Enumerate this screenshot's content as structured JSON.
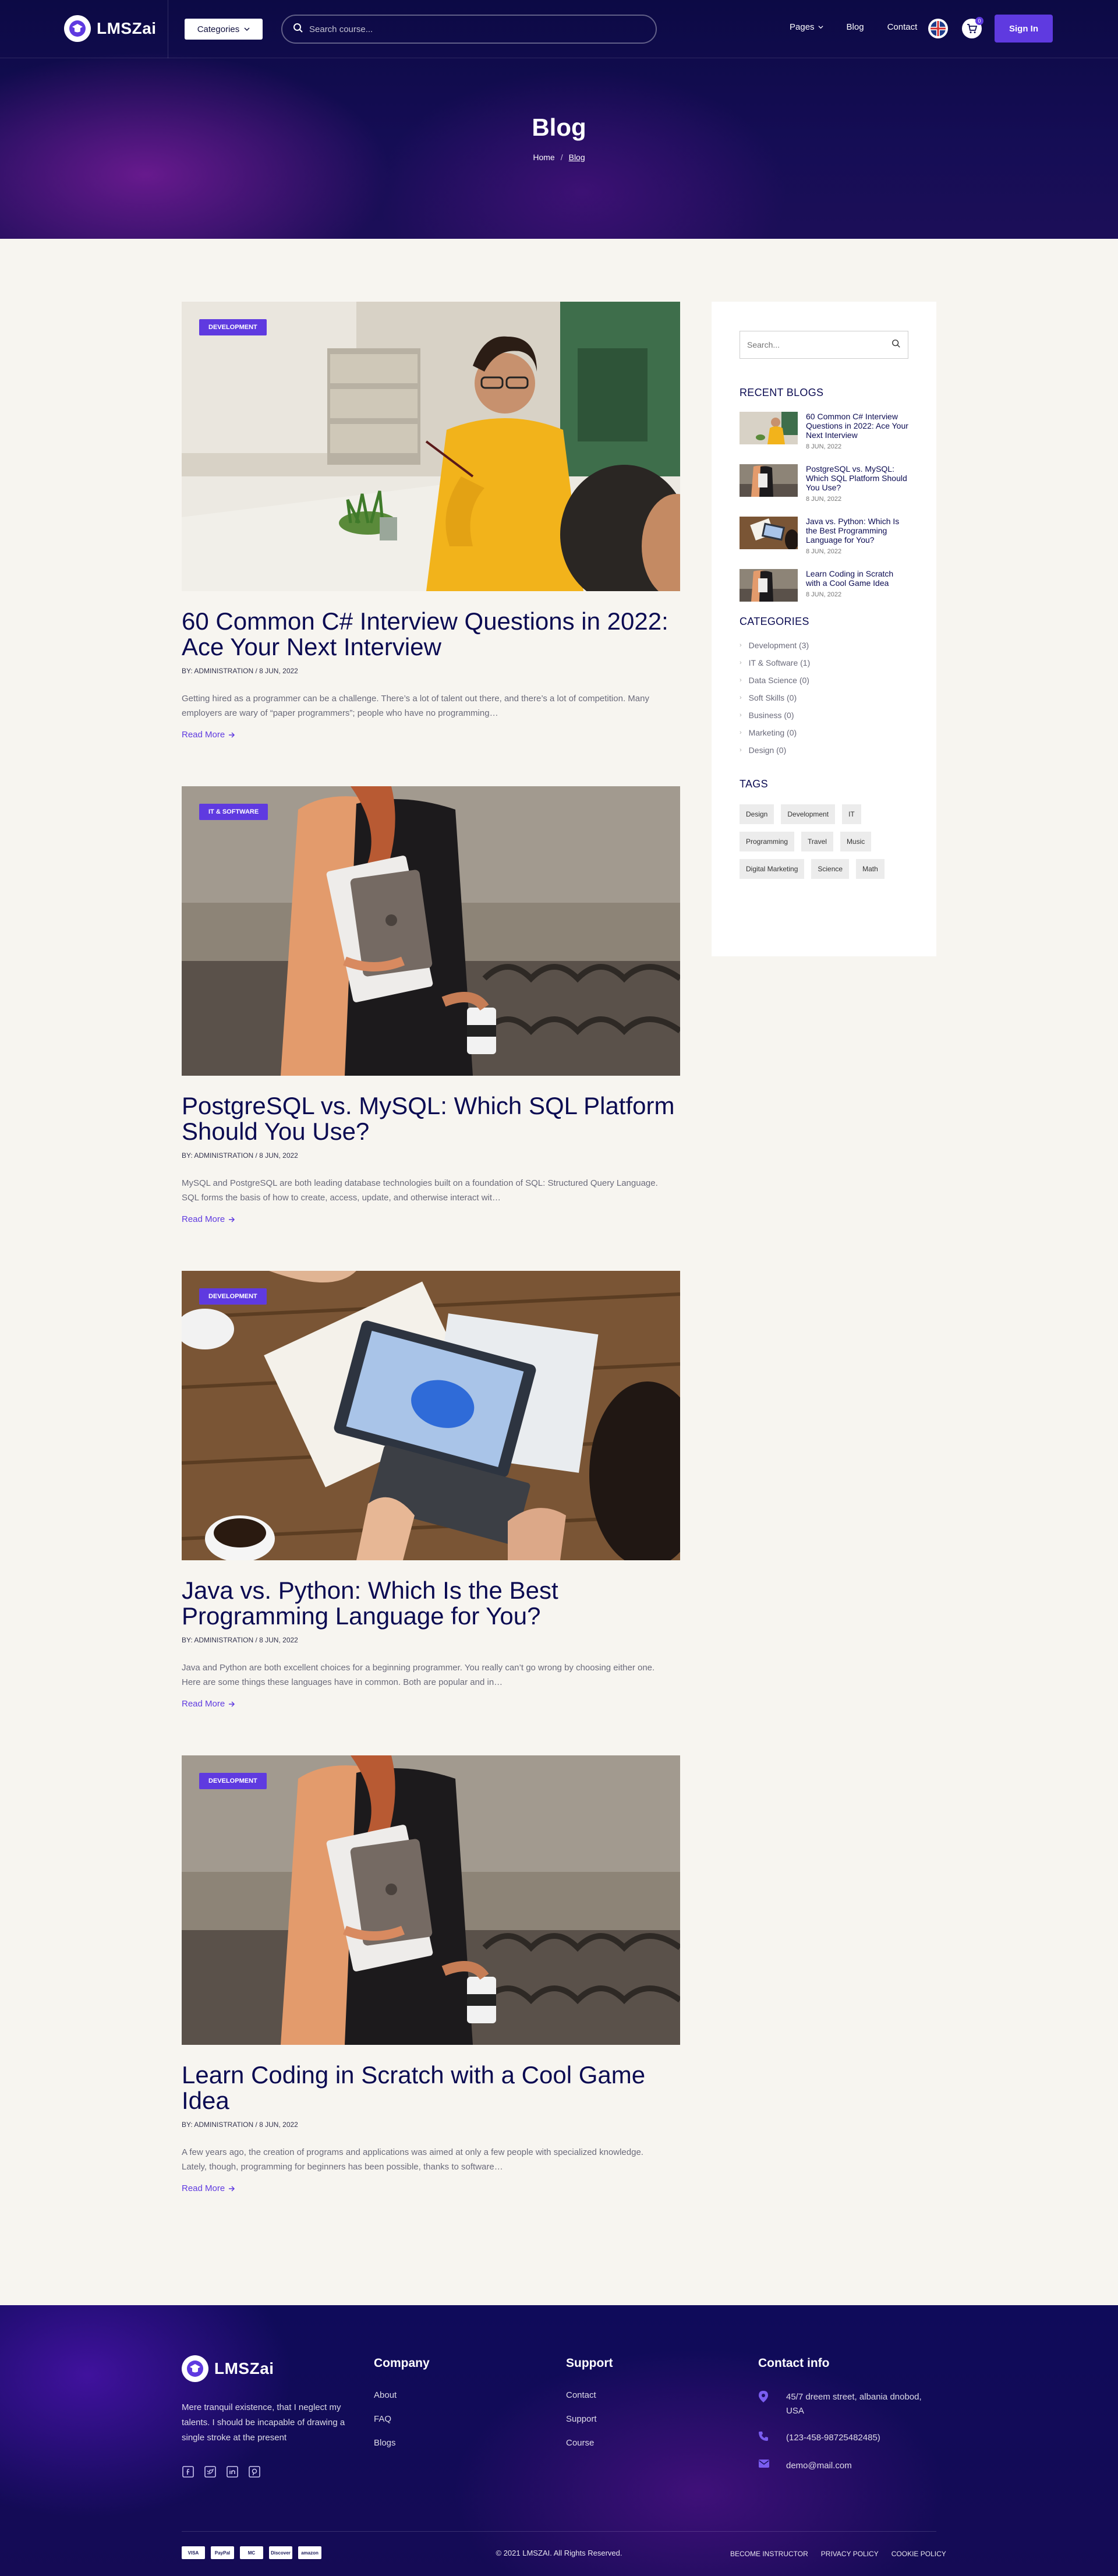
{
  "brand": {
    "name": "LMSZai"
  },
  "header": {
    "categories_label": "Categories",
    "search_placeholder": "Search course...",
    "nav": [
      "Pages",
      "Blog",
      "Contact"
    ],
    "cart_count": "0",
    "signin_label": "Sign In"
  },
  "hero": {
    "title": "Blog",
    "breadcrumb": [
      "Home",
      "Blog"
    ]
  },
  "posts": [
    {
      "category": "DEVELOPMENT",
      "title": "60 Common C# Interview Questions in 2022: Ace Your Next Interview",
      "meta": "BY: ADMINISTRATION / 8 JUN, 2022",
      "excerpt": "Getting hired as a programmer can be a challenge. There’s a lot of talent out there, and there’s a lot of competition. Many employers are wary of “paper programmers”; people who have no programming…",
      "read_more": "Read More"
    },
    {
      "category": "IT & SOFTWARE",
      "title": "PostgreSQL vs. MySQL: Which SQL Platform Should You Use?",
      "meta": "BY: ADMINISTRATION / 8 JUN, 2022",
      "excerpt": "MySQL and PostgreSQL are both leading database technologies built on a foundation of SQL: Structured Query Language. SQL forms the basis of how to create, access, update, and otherwise interact wit…",
      "read_more": "Read More"
    },
    {
      "category": "DEVELOPMENT",
      "title": "Java vs. Python: Which Is the Best Programming Language for You?",
      "meta": "BY: ADMINISTRATION / 8 JUN, 2022",
      "excerpt": "Java and Python are both excellent choices for a beginning programmer. You really can’t go wrong by choosing either one. Here are some things these languages have in common. Both are popular and in…",
      "read_more": "Read More"
    },
    {
      "category": "DEVELOPMENT",
      "title": "Learn Coding in Scratch with a Cool Game Idea",
      "meta": "BY: ADMINISTRATION / 8 JUN, 2022",
      "excerpt": "A few years ago, the creation of programs and applications was aimed at only a few people with specialized knowledge. Lately, though, programming for beginners has been possible, thanks to software…",
      "read_more": "Read More"
    }
  ],
  "sidebar": {
    "search_placeholder": "Search...",
    "recent_heading": "RECENT BLOGS",
    "recent": [
      {
        "title": "60 Common C# Interview Questions in 2022: Ace Your Next Interview",
        "date": "8 JUN, 2022"
      },
      {
        "title": "PostgreSQL vs. MySQL: Which SQL Platform Should You Use?",
        "date": "8 JUN, 2022"
      },
      {
        "title": "Java vs. Python: Which Is the Best Programming Language for You?",
        "date": "8 JUN, 2022"
      },
      {
        "title": "Learn Coding in Scratch with a Cool Game Idea",
        "date": "8 JUN, 2022"
      }
    ],
    "categories_heading": "CATEGORIES",
    "categories": [
      "Development (3)",
      "IT & Software (1)",
      "Data Science (0)",
      "Soft Skills (0)",
      "Business (0)",
      "Marketing (0)",
      "Design (0)"
    ],
    "tags_heading": "TAGS",
    "tags": [
      "Design",
      "Development",
      "IT",
      "Programming",
      "Travel",
      "Music",
      "Digital Marketing",
      "Science",
      "Math"
    ]
  },
  "footer": {
    "about": "Mere tranquil existence, that I neglect my talents. I should be incapable of drawing a single stroke at the present",
    "company_heading": "Company",
    "company_links": [
      "About",
      "FAQ",
      "Blogs"
    ],
    "support_heading": "Support",
    "support_links": [
      "Contact",
      "Support",
      "Course"
    ],
    "contact_heading": "Contact info",
    "address": "45/7 dreem street, albania dnobod, USA",
    "phone": "(123-458-98725482485)",
    "email": "demo@mail.com",
    "payments": [
      "VISA",
      "PayPal",
      "MC",
      "Discover",
      "amazon"
    ],
    "copyright": "© 2021 LMSZAI. All Rights Reserved.",
    "legal": [
      "BECOME INSTRUCTOR",
      "PRIVACY POLICY",
      "COOKIE POLICY"
    ]
  },
  "colors": {
    "accent": "#5f3ae0",
    "navy": "#0b0b52",
    "page_bg": "#f7f5f0"
  },
  "icons": {
    "logo": "graduation-cap-icon",
    "search": "search-icon",
    "cart": "cart-icon",
    "language": "uk-flag-icon",
    "read_more": "arrow-right-icon"
  }
}
